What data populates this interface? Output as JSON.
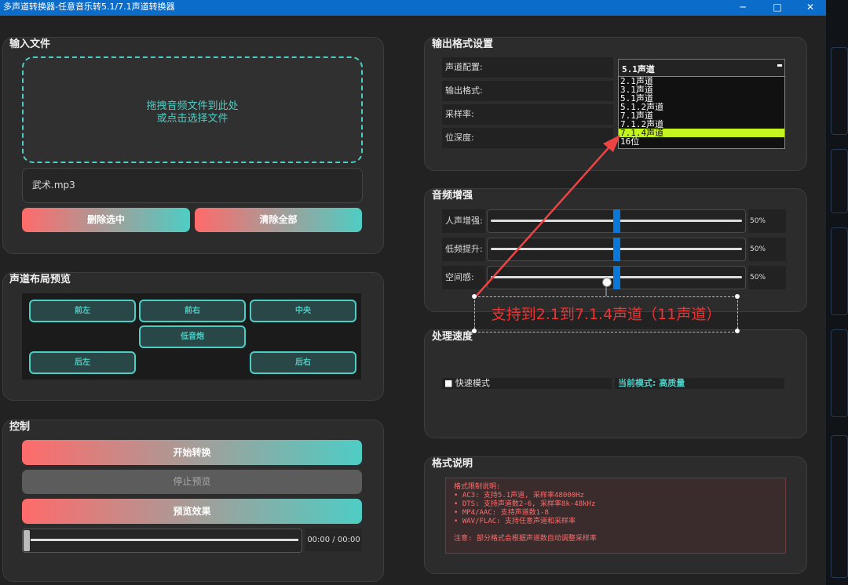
{
  "window": {
    "title": "多声道转换器-任意音乐转5.1/7.1声道转换器",
    "minimize": "─",
    "maximize": "□",
    "close": "✕"
  },
  "input_panel": {
    "title": "输入文件",
    "drop_line1": "拖拽音频文件到此处",
    "drop_line2": "或点击选择文件",
    "file": "武术.mp3",
    "delete_selected": "删除选中",
    "clear_all": "清除全部"
  },
  "layout_panel": {
    "title": "声道布局预览",
    "front_left": "前左",
    "front_right": "前右",
    "center": "中央",
    "subwoofer": "低音炮",
    "rear_left": "后左",
    "rear_right": "后右"
  },
  "control_panel": {
    "title": "控制",
    "start": "开始转换",
    "stop_preview": "停止预览",
    "preview": "预览效果",
    "time": "00:00 / 00:00",
    "progress": 0
  },
  "output_panel": {
    "title": "输出格式设置",
    "channel_label": "声道配置:",
    "format_label": "输出格式:",
    "samplerate_label": "采样率:",
    "bitdepth_label": "位深度:",
    "channel_value": "5.1声道",
    "dropdown_arrow": "▬",
    "options": [
      "2.1声道",
      "3.1声道",
      "5.1声道",
      "5.1.2声道",
      "7.1声道",
      "7.1.2声道",
      "7.1.4声道"
    ],
    "selected_option": "7.1.4声道",
    "bitdepth_value": "16位"
  },
  "enhance_panel": {
    "title": "音频增强",
    "sliders": [
      {
        "label": "人声增强:",
        "value": "50%",
        "level": 0.5
      },
      {
        "label": "低频提升:",
        "value": "50%",
        "level": 0.5
      },
      {
        "label": "空间感:",
        "value": "50%",
        "level": 0.5
      }
    ]
  },
  "speed_panel": {
    "title": "处理速度",
    "checkbox_mark": "■",
    "fast_mode": "快速模式",
    "current_mode": "当前模式: 高质量"
  },
  "notes_panel": {
    "title": "格式说明",
    "lines": [
      "格式限制说明:",
      "• AC3: 支持5.1声道, 采样率48000Hz",
      "• DTS: 支持声道数2-6, 采样率8k-48kHz",
      "• MP4/AAC: 支持声道数1-8",
      "• WAV/FLAC: 支持任意声道和采样率",
      "",
      "注意: 部分格式会根据声道数自动调整采样率"
    ]
  },
  "annotation": {
    "text": "支持到2.1到7.1.4声道（11声道）",
    "color": "#ee3333"
  },
  "colors": {
    "accent": "#4ecdc4",
    "gradient_start": "#ff6b6b",
    "titlebar": "#0b6cc9",
    "dropdown_selected": "#c4f520",
    "slider_handle": "#0a78d8"
  }
}
